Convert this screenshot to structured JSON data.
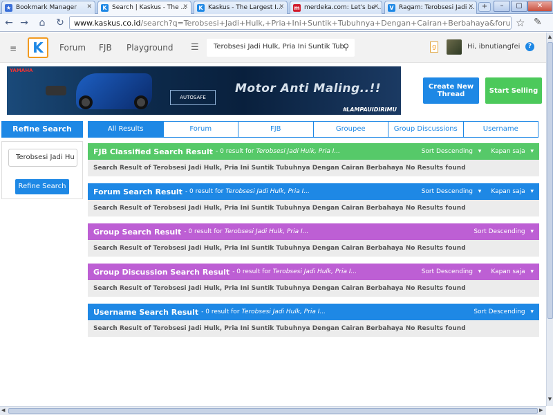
{
  "browser": {
    "tabs": [
      {
        "title": "Bookmark Manager",
        "icon": "star-icon",
        "color": "#3a6fd8",
        "glyph": "★"
      },
      {
        "title": "Search | Kaskus - The ...",
        "icon": "kaskus-icon",
        "color": "#1e88e5",
        "glyph": "K"
      },
      {
        "title": "Kaskus - The Largest I...",
        "icon": "kaskus-icon",
        "color": "#1e88e5",
        "glyph": "K"
      },
      {
        "title": "merdeka.com: Let's be ...",
        "icon": "merdeka-icon",
        "color": "#d11a2a",
        "glyph": "m"
      },
      {
        "title": "Ragam: Terobsesi Jadi ...",
        "icon": "vivanews-icon",
        "color": "#1e88e5",
        "glyph": "V"
      }
    ],
    "new_tab": "+",
    "window": {
      "minimize": "–",
      "maximize": "▢",
      "close": "✕"
    },
    "nav": {
      "back": "←",
      "forward": "→",
      "home": "⌂",
      "reload": "↻"
    },
    "url_host": "www.kaskus.co.id",
    "url_rest": "/search?q=Terobsesi+Jadi+Hulk,+Pria+Ini+Suntik+Tubuhnya+Dengan+Cairan+Berbahaya&forumchoice="
  },
  "header": {
    "menu_icon": "≡",
    "logo_glyph": "K",
    "nav": [
      "Forum",
      "FJB",
      "Playground"
    ],
    "search_value": "Terobsesi Jadi Hulk, Pria Ini Suntik Tub",
    "notif": "g",
    "greeting": "Hi, ibnutiangfei",
    "help": "?"
  },
  "banner": {
    "brand": "YAMAHA",
    "product": "AUTOSAFE",
    "slogan": "Motor Anti Maling..!!",
    "hashtag": "#LAMPAUIDIRIMU"
  },
  "actions": {
    "create_thread": "Create New Thread",
    "start_selling": "Start Selling"
  },
  "refine": {
    "title": "Refine Search",
    "input_value": "Terobsesi Jadi Hu",
    "button": "Refine Search"
  },
  "filter_tabs": [
    "All Results",
    "Forum",
    "FJB",
    "Groupee",
    "Group Discussions",
    "Username"
  ],
  "sections": [
    {
      "title": "FJB Classified Search Result",
      "count": "- 0 result for",
      "query": "Terobsesi Jadi Hulk, Pria I...",
      "sort": "Sort Descending",
      "time": "Kapan saja",
      "body": "Search Result of Terobsesi Jadi Hulk, Pria Ini Suntik Tubuhnya Dengan Cairan Berbahaya No Results found"
    },
    {
      "title": "Forum Search Result",
      "count": "- 0 result for",
      "query": "Terobsesi Jadi Hulk, Pria I...",
      "sort": "Sort Descending",
      "time": "Kapan saja",
      "body": "Search Result of Terobsesi Jadi Hulk, Pria Ini Suntik Tubuhnya Dengan Cairan Berbahaya No Results found"
    },
    {
      "title": "Group Search Result",
      "count": "- 0 result for",
      "query": "Terobsesi Jadi Hulk, Pria I...",
      "sort": "Sort Descending",
      "time": "",
      "body": "Search Result of Terobsesi Jadi Hulk, Pria Ini Suntik Tubuhnya Dengan Cairan Berbahaya No Results found"
    },
    {
      "title": "Group Discussion Search Result",
      "count": "- 0 result for",
      "query": "Terobsesi Jadi Hulk, Pria I...",
      "sort": "Sort Descending",
      "time": "Kapan saja",
      "body": "Search Result of Terobsesi Jadi Hulk, Pria Ini Suntik Tubuhnya Dengan Cairan Berbahaya No Results found"
    },
    {
      "title": "Username Search Result",
      "count": "- 0 result for",
      "query": "Terobsesi Jadi Hulk, Pria I...",
      "sort": "Sort Descending",
      "time": "",
      "body": "Search Result of Terobsesi Jadi Hulk, Pria Ini Suntik Tubuhnya Dengan Cairan Berbahaya No Results found"
    }
  ],
  "colors": {
    "kaskus_blue": "#1e88e5",
    "green": "#56c969",
    "purple": "#bd5fd4",
    "orange": "#f29a1f"
  }
}
